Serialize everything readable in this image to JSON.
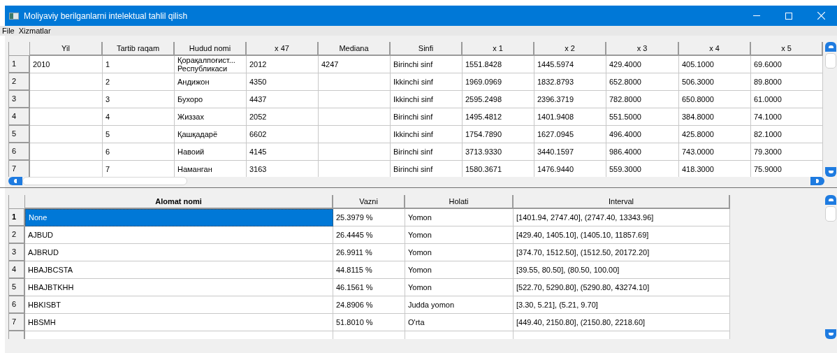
{
  "window": {
    "title": "Moliyaviy berilganlarni intelektual tahlil qilish"
  },
  "menu": [
    "File",
    "Xizmatlar"
  ],
  "top_table": {
    "columns": [
      "Yil",
      "Tartib raqam",
      "Hudud nomi",
      "x 47",
      "Mediana",
      "Sinfi",
      "x 1",
      "x 2",
      "x 3",
      "x 4",
      "x 5"
    ],
    "rows": [
      {
        "number": "1",
        "cells": [
          "2010",
          "1",
          "Қорақалпоғист...\nРеспубликаси",
          "2012",
          "4247",
          "Birinchi sinf",
          "1551.8428",
          "1445.5974",
          "429.4000",
          "405.1000",
          "69.6000"
        ]
      },
      {
        "number": "2",
        "cells": [
          "",
          "2",
          "Андижон",
          "4350",
          "",
          "Ikkinchi sinf",
          "1969.0969",
          "1832.8793",
          "652.8000",
          "506.3000",
          "89.8000"
        ]
      },
      {
        "number": "3",
        "cells": [
          "",
          "3",
          "Бухоро",
          "4437",
          "",
          "Ikkinchi sinf",
          "2595.2498",
          "2396.3719",
          "782.8000",
          "650.8000",
          "61.0000"
        ]
      },
      {
        "number": "4",
        "cells": [
          "",
          "4",
          "Жиззах",
          "2052",
          "",
          "Birinchi sinf",
          "1495.4812",
          "1401.9408",
          "551.5000",
          "384.8000",
          "74.1000"
        ]
      },
      {
        "number": "5",
        "cells": [
          "",
          "5",
          "Қашқадарё",
          "6602",
          "",
          "Ikkinchi sinf",
          "1754.7890",
          "1627.0945",
          "496.4000",
          "425.8000",
          "82.1000"
        ]
      },
      {
        "number": "6",
        "cells": [
          "",
          "6",
          "Навоий",
          "4145",
          "",
          "Birinchi sinf",
          "3713.9330",
          "3440.1597",
          "986.4000",
          "743.0000",
          "79.3000"
        ]
      },
      {
        "number": "7",
        "cells": [
          "",
          "7",
          "Наманган",
          "3163",
          "",
          "Birinchi sinf",
          "1580.3671",
          "1476.9440",
          "559.3000",
          "418.3000",
          "75.9000"
        ]
      }
    ]
  },
  "bottom_table": {
    "columns": [
      "Alomat nomi",
      "Vazni",
      "Holati",
      "Interval"
    ],
    "rows": [
      {
        "number": "1",
        "selected": true,
        "cells": [
          "None",
          "25.3979 %",
          "Yomon",
          "[1401.94, 2747.40], (2747.40, 13343.96]"
        ]
      },
      {
        "number": "2",
        "selected": false,
        "cells": [
          "AJBUD",
          "26.4445 %",
          "Yomon",
          "[429.40, 1405.10], (1405.10, 11857.69]"
        ]
      },
      {
        "number": "3",
        "selected": false,
        "cells": [
          "AJBRUD",
          "26.9911 %",
          "Yomon",
          "[374.70, 1512.50], (1512.50, 20172.20]"
        ]
      },
      {
        "number": "4",
        "selected": false,
        "cells": [
          "HBAJBCSTA",
          "44.8115 %",
          "Yomon",
          "[39.55, 80.50], (80.50, 100.00]"
        ]
      },
      {
        "number": "5",
        "selected": false,
        "cells": [
          "HBAJBTKHH",
          "46.1561 %",
          "Yomon",
          "[522.70, 5290.80], (5290.80, 43274.10]"
        ]
      },
      {
        "number": "6",
        "selected": false,
        "cells": [
          "HBKISBT",
          "24.8906 %",
          "Judda yomon",
          "[3.30, 5.21], (5.21, 9.70]"
        ]
      },
      {
        "number": "7",
        "selected": false,
        "cells": [
          "HBSMH",
          "51.8010 %",
          "O'rta",
          "[449.40, 2150.80], (2150.80, 2218.60]"
        ]
      }
    ]
  }
}
